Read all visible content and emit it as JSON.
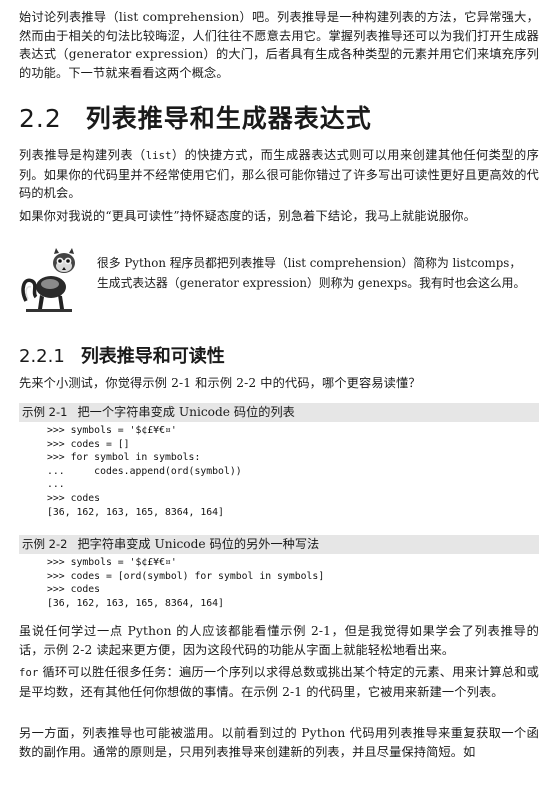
{
  "intro": {
    "text": "始讨论列表推导（list comprehension）吧。列表推导是一种构建列表的方法，它异常强大，然而由于相关的句法比较晦涩，人们往往不愿意去用它。掌握列表推导还可以为我们打开生成器表达式（generator expression）的大门，后者具有生成各种类型的元素并用它们来填充序列的功能。下一节就来看看这两个概念。"
  },
  "section": {
    "number": "2.2",
    "title": "列表推导和生成器表达式"
  },
  "para1": {
    "before": "列表推导是构建列表（",
    "code": "list",
    "after": "）的快捷方式，而生成器表达式则可以用来创建其他任何类型的序列。如果你的代码里并不经常使用它们，那么很可能你错过了许多写出可读性更好且更高效的代码的机会。"
  },
  "para2": {
    "text": "如果你对我说的“更具可读性”持怀疑态度的话，别急着下结论，我马上就能说服你。"
  },
  "note": {
    "text": "很多 Python 程序员都把列表推导（list comprehension）简称为 listcomps，生成式表达器（generator expression）则称为 genexps。我有时也会这么用。"
  },
  "subsection": {
    "number": "2.2.1",
    "title": "列表推导和可读性"
  },
  "para3": {
    "text": "先来个小测试，你觉得示例 2-1 和示例 2-2 中的代码，哪个更容易读懂？"
  },
  "example1": {
    "label": "示例 2-1",
    "title": "把一个字符串变成 Unicode 码位的列表",
    "code": ">>> symbols = '$¢£¥€¤'\n>>> codes = []\n>>> for symbol in symbols:\n...     codes.append(ord(symbol))\n...\n>>> codes\n[36, 162, 163, 165, 8364, 164]"
  },
  "example2": {
    "label": "示例 2-2",
    "title": "把字符串变成 Unicode 码位的另外一种写法",
    "code": ">>> symbols = '$¢£¥€¤'\n>>> codes = [ord(symbol) for symbol in symbols]\n>>> codes\n[36, 162, 163, 165, 8364, 164]"
  },
  "para4": {
    "text": "虽说任何学过一点 Python 的人应该都能看懂示例 2-1，但是我觉得如果学会了列表推导的话，示例 2-2 读起来更方便，因为这段代码的功能从字面上就能轻松地看出来。"
  },
  "para5": {
    "code": "for",
    "after": " 循环可以胜任很多任务：遍历一个序列以求得总数或挑出某个特定的元素、用来计算总和或是平均数，还有其他任何你想做的事情。在示例 2-1 的代码里，它被用来新建一个列表。"
  },
  "para6": {
    "text": "另一方面，列表推导也可能被滥用。以前看到过的 Python 代码用列表推导来重复获取一个函数的副作用。通常的原则是，只用列表推导来创建新的列表，并且尽量保持简短。如"
  }
}
